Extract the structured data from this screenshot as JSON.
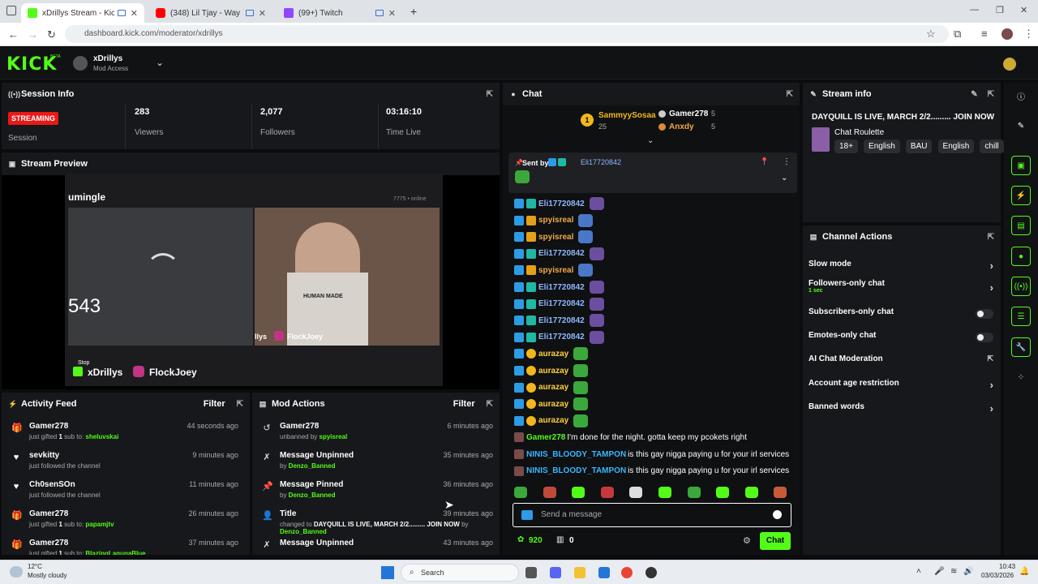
{
  "browser": {
    "tabs": [
      {
        "label": "xDrillys Stream - Kick Dashb",
        "active": true,
        "fav_color": "#53fc18"
      },
      {
        "label": "(348) Lil Tjay - Way Out The",
        "active": false,
        "fav_color": "#ff0000"
      },
      {
        "label": "(99+) Twitch",
        "active": false,
        "fav_color": "#9146ff"
      }
    ],
    "url": "dashboard.kick.com/moderator/xdrillys",
    "new_tab": "+"
  },
  "app": {
    "logo": "KICK",
    "logo_beta": "BETA",
    "channel_name": "xDrillys",
    "access": "Mod Access",
    "accent": "#53fc18"
  },
  "session": {
    "title": "Session Info",
    "status_badge": "STREAMING",
    "status_label": "Session",
    "viewers": "283",
    "viewers_label": "Viewers",
    "followers": "2,077",
    "followers_label": "Followers",
    "time_live": "03:16:10",
    "time_live_label": "Time Live"
  },
  "preview": {
    "title": "Stream Preview",
    "site_label": "umingle",
    "online_count": "543",
    "kick_name": "xDrillys",
    "ig_name": "FlockJoey",
    "cam_name": "FlockJoey",
    "cam_prefix": "llys",
    "hero_text": "HUMAN MADE",
    "stop_label": "Stop",
    "inner_online": "7775 • online"
  },
  "activity": {
    "title": "Activity Feed",
    "filter": "Filter",
    "items": [
      {
        "name": "Gamer278",
        "pre": "just gifted ",
        "count": "1",
        "mid": " sub to: ",
        "target": "sheluvskai",
        "time": "44 seconds ago",
        "icon": "gift-icon"
      },
      {
        "name": "sevkitty",
        "pre": "just followed the channel",
        "count": "",
        "mid": "",
        "target": "",
        "time": "9 minutes ago",
        "icon": "heart-icon"
      },
      {
        "name": "Ch0senSOn",
        "pre": "just followed the channel",
        "count": "",
        "mid": "",
        "target": "",
        "time": "11 minutes ago",
        "icon": "heart-icon"
      },
      {
        "name": "Gamer278",
        "pre": "just gifted ",
        "count": "1",
        "mid": " sub to: ",
        "target": "papamjtv",
        "time": "26 minutes ago",
        "icon": "gift-icon"
      },
      {
        "name": "Gamer278",
        "pre": "just gifted ",
        "count": "1",
        "mid": " sub to: ",
        "target": "BlazingLagunaBlue",
        "time": "37 minutes ago",
        "icon": "gift-icon"
      }
    ]
  },
  "mod_actions": {
    "title": "Mod Actions",
    "filter": "Filter",
    "items": [
      {
        "name": "Gamer278",
        "pre": "unbanned by ",
        "target": "spyisreal",
        "time": "6 minutes ago",
        "icon": "undo-icon"
      },
      {
        "name": "Message Unpinned",
        "pre": "by ",
        "target": "Denzo_Banned",
        "time": "35 minutes ago",
        "icon": "unpin-icon"
      },
      {
        "name": "Message Pinned",
        "pre": "by ",
        "target": "Denzo_Banned",
        "time": "36 minutes ago",
        "icon": "pin-icon"
      },
      {
        "name": "Title",
        "pre": "changed to ",
        "bold": "DAYQUILL IS LIVE, MARCH 2/2......... JOIN NOW",
        "by": " by",
        "target": "Denzo_Banned",
        "time": "39 minutes ago",
        "icon": "user-edit-icon"
      },
      {
        "name": "Message Unpinned",
        "pre": "",
        "target": "",
        "time": "43 minutes ago",
        "icon": "unpin-icon"
      }
    ]
  },
  "chat": {
    "title": "Chat",
    "leaders": [
      {
        "rank": "1",
        "name": "SammyySosaa",
        "count": "25"
      },
      {
        "name": "Gamer278",
        "count": "5"
      },
      {
        "name": "Anxdy",
        "count": "5"
      }
    ],
    "pinned": {
      "label": "Sent by",
      "user": "Eli17720842"
    },
    "messages": [
      {
        "user": "Eli17720842",
        "color": "#8fb8ff",
        "badges": [
          "b-blue",
          "b-teal"
        ],
        "text": ""
      },
      {
        "user": "spyisreal",
        "color": "#f0a94a",
        "badges": [
          "b-blue",
          "b-gold"
        ],
        "text": ""
      },
      {
        "user": "spyisreal",
        "color": "#f0a94a",
        "badges": [
          "b-blue",
          "b-gold"
        ],
        "text": ""
      },
      {
        "user": "Eli17720842",
        "color": "#8fb8ff",
        "badges": [
          "b-blue",
          "b-teal"
        ],
        "text": ""
      },
      {
        "user": "spyisreal",
        "color": "#f0a94a",
        "badges": [
          "b-blue",
          "b-gold"
        ],
        "text": ""
      },
      {
        "user": "Eli17720842",
        "color": "#8fb8ff",
        "badges": [
          "b-blue",
          "b-teal"
        ],
        "text": ""
      },
      {
        "user": "Eli17720842",
        "color": "#8fb8ff",
        "badges": [
          "b-blue",
          "b-teal"
        ],
        "text": ""
      },
      {
        "user": "Eli17720842",
        "color": "#8fb8ff",
        "badges": [
          "b-blue",
          "b-teal"
        ],
        "text": ""
      },
      {
        "user": "Eli17720842",
        "color": "#8fb8ff",
        "badges": [
          "b-blue",
          "b-teal"
        ],
        "text": ""
      },
      {
        "user": "aurazay",
        "color": "#ffd23c",
        "badges": [
          "b-blue",
          "b-ylw"
        ],
        "text": ""
      },
      {
        "user": "aurazay",
        "color": "#ffd23c",
        "badges": [
          "b-blue",
          "b-ylw"
        ],
        "text": ""
      },
      {
        "user": "aurazay",
        "color": "#ffd23c",
        "badges": [
          "b-blue",
          "b-ylw"
        ],
        "text": ""
      },
      {
        "user": "aurazay",
        "color": "#ffd23c",
        "badges": [
          "b-blue",
          "b-ylw"
        ],
        "text": ""
      },
      {
        "user": "aurazay",
        "color": "#ffd23c",
        "badges": [
          "b-blue",
          "b-ylw"
        ],
        "text": ""
      },
      {
        "user": "Gamer278",
        "color": "#53fc18",
        "badges": [],
        "text": "I'm done for the night. gotta keep my pcokets right"
      },
      {
        "user": "NINIS_BLOODY_TAMPON",
        "color": "#3ab6ff",
        "badges": [],
        "text": "is this gay nigga paying u for your irl services"
      },
      {
        "user": "NINIS_BLOODY_TAMPON",
        "color": "#3ab6ff",
        "badges": [],
        "text": "is this gay nigga paying u for your irl services"
      }
    ],
    "input_placeholder": "Send a message",
    "points": "920",
    "store_count": "0",
    "chat_button": "Chat"
  },
  "stream_info": {
    "title": "Stream info",
    "stream_title": "DAYQUILL IS LIVE, MARCH 2/2......... JOIN NOW",
    "category": "Chat Roulette",
    "tags": [
      "18+",
      "English",
      "BAU",
      "English",
      "chill"
    ]
  },
  "channel_actions": {
    "title": "Channel Actions",
    "slow_mode": "Slow mode",
    "followers_only": "Followers-only chat",
    "followers_only_sub": "1 sec",
    "subscribers_only": "Subscribers-only chat",
    "emotes_only": "Emotes-only chat",
    "ai_moderation": "AI Chat Moderation",
    "account_age": "Account age restriction",
    "banned_words": "Banned words"
  },
  "taskbar": {
    "temp": "12°C",
    "weather": "Mostly cloudy",
    "search": "Search",
    "time": "10:43",
    "date": "03/03/2026"
  }
}
